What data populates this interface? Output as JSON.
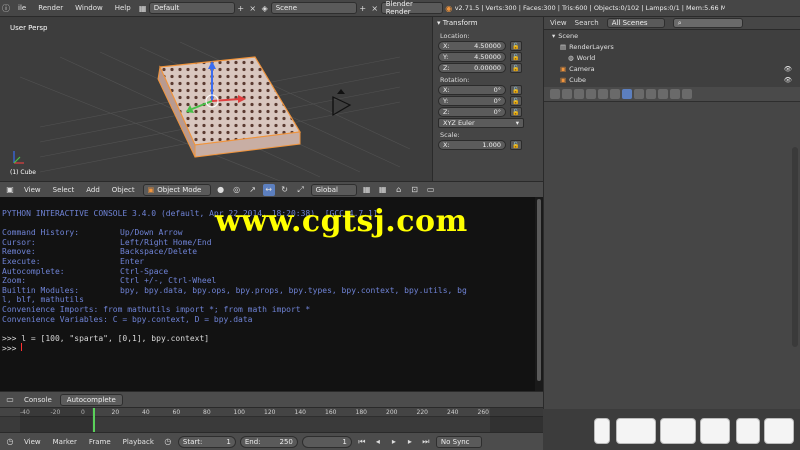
{
  "topbar": {
    "menus": [
      "ile",
      "Render",
      "Window",
      "Help"
    ],
    "screen_layout": "Default",
    "scene": "Scene",
    "engine": "Blender Render",
    "stats": "v2.71.5 | Verts:300 | Faces:300 | Tris:600 | Objects:0/102 | Lamps:0/1 | Mem:5.66 M"
  },
  "viewport": {
    "view_label": "User Persp",
    "object_label": "(1) Cube"
  },
  "npanel": {
    "title": "Transform",
    "location_label": "Location:",
    "location": [
      {
        "axis": "X:",
        "value": "4.50000"
      },
      {
        "axis": "Y:",
        "value": "4.50000"
      },
      {
        "axis": "Z:",
        "value": "0.00000"
      }
    ],
    "rotation_label": "Rotation:",
    "rotation": [
      {
        "axis": "X:",
        "value": "0°"
      },
      {
        "axis": "Y:",
        "value": "0°"
      },
      {
        "axis": "Z:",
        "value": "0°"
      }
    ],
    "rotation_mode": "XYZ Euler",
    "scale_label": "Scale:",
    "scale": [
      {
        "axis": "X:",
        "value": "1.000"
      }
    ]
  },
  "outliner": {
    "view_label": "View",
    "search_label": "Search",
    "scope": "All Scenes",
    "rows": [
      "Scene",
      "RenderLayers",
      "World",
      "Camera",
      "Cube"
    ]
  },
  "vphead": {
    "view": "View",
    "select": "Select",
    "add": "Add",
    "object": "Object",
    "mode": "Object Mode",
    "orientation": "Global"
  },
  "console": {
    "banner": "PYTHON INTERACTIVE CONSOLE 3.4.0 (default, Apr 22 2014, 18:20:38)  [GCC 4.7.1]",
    "help": [
      {
        "key": "Command History:",
        "val": "Up/Down Arrow"
      },
      {
        "key": "Cursor:",
        "val": "Left/Right Home/End"
      },
      {
        "key": "Remove:",
        "val": "Backspace/Delete"
      },
      {
        "key": "Execute:",
        "val": "Enter"
      },
      {
        "key": "Autocomplete:",
        "val": "Ctrl-Space"
      },
      {
        "key": "Zoom:",
        "val": "Ctrl +/-, Ctrl-Wheel"
      },
      {
        "key": "Builtin Modules:",
        "val": "bpy, bpy.data, bpy.ops, bpy.props, bpy.types, bpy.context, bpy.utils, bg"
      }
    ],
    "builtin_cont": "l, blf, mathutils",
    "imports": "Convenience Imports: from mathutils import *; from math import *",
    "variables": "Convenience Variables: C = bpy.context, D = bpy.data",
    "input_line": ">>> l = [100, \"sparta\", [0,1], bpy.context]",
    "prompt": ">>> "
  },
  "conhead": {
    "console_label": "Console",
    "autocomplete_label": "Autocomplete"
  },
  "timeline": {
    "ticks": [
      "-40",
      "-20",
      "0",
      "20",
      "40",
      "60",
      "80",
      "100",
      "120",
      "140",
      "160",
      "180",
      "200",
      "220",
      "240",
      "260"
    ],
    "view": "View",
    "marker": "Marker",
    "frame": "Frame",
    "playback": "Playback",
    "start": "Start:",
    "start_val": "1",
    "end": "End:",
    "end_val": "250",
    "current": "1",
    "sync": "No Sync"
  },
  "watermark": "www.cgtsj.com",
  "colors": {
    "console_blue": "#6f83d6",
    "selection_orange": "#f0943c",
    "watermark_yellow": "#ffff00"
  }
}
